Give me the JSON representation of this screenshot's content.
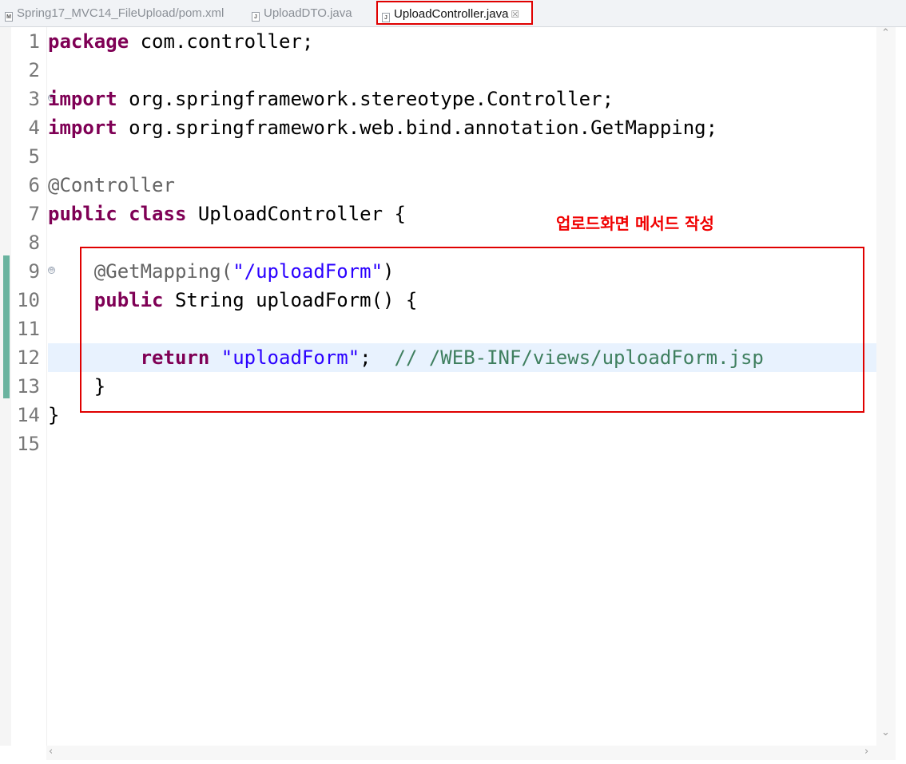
{
  "tabs": [
    {
      "icon": "maven-xml-file-icon",
      "icon_glyph": "M",
      "label": "Spring17_MVC14_FileUpload/pom.xml",
      "active": false
    },
    {
      "icon": "java-file-icon",
      "icon_glyph": "J",
      "label": "UploadDTO.java",
      "active": false
    },
    {
      "icon": "java-file-icon",
      "icon_glyph": "J",
      "label": "UploadController.java",
      "active": true,
      "close_glyph": "☒"
    }
  ],
  "editor": {
    "line_numbers": [
      "1",
      "2",
      "3",
      "4",
      "5",
      "6",
      "7",
      "8",
      "9",
      "10",
      "11",
      "12",
      "13",
      "14",
      "15"
    ],
    "fold_glyph": "⊖",
    "lines": {
      "l1": {
        "kw": "package",
        "rest": " com.controller;"
      },
      "l3": {
        "kw": "import",
        "rest": " org.springframework.stereotype.Controller;"
      },
      "l4": {
        "kw": "import",
        "rest": " org.springframework.web.bind.annotation.GetMapping;"
      },
      "l6": {
        "ann": "@Controller"
      },
      "l7": {
        "kw1": "public",
        "kw2": "class",
        "rest": " UploadController {"
      },
      "l9": {
        "ann": "@GetMapping(",
        "str": "\"/uploadForm\"",
        "rest": ")"
      },
      "l10": {
        "kw": "public",
        "rest": " String uploadForm() {"
      },
      "l12": {
        "kw": "return",
        "str": "\"uploadForm\"",
        "rest": ";",
        "comment": "// /WEB-INF/views/uploadForm.jsp"
      },
      "l13": {
        "rest": "}"
      },
      "l14": {
        "rest": "}"
      }
    },
    "annotation_caption": "업로드화면 메서드 작성",
    "highlight_color": "#e00000",
    "current_line": "12"
  },
  "colors": {
    "keyword": "#7f0055",
    "string": "#2a00ff",
    "comment": "#3f7f5f",
    "annotation": "#646464",
    "current_line_bg": "#e8f2fe"
  }
}
